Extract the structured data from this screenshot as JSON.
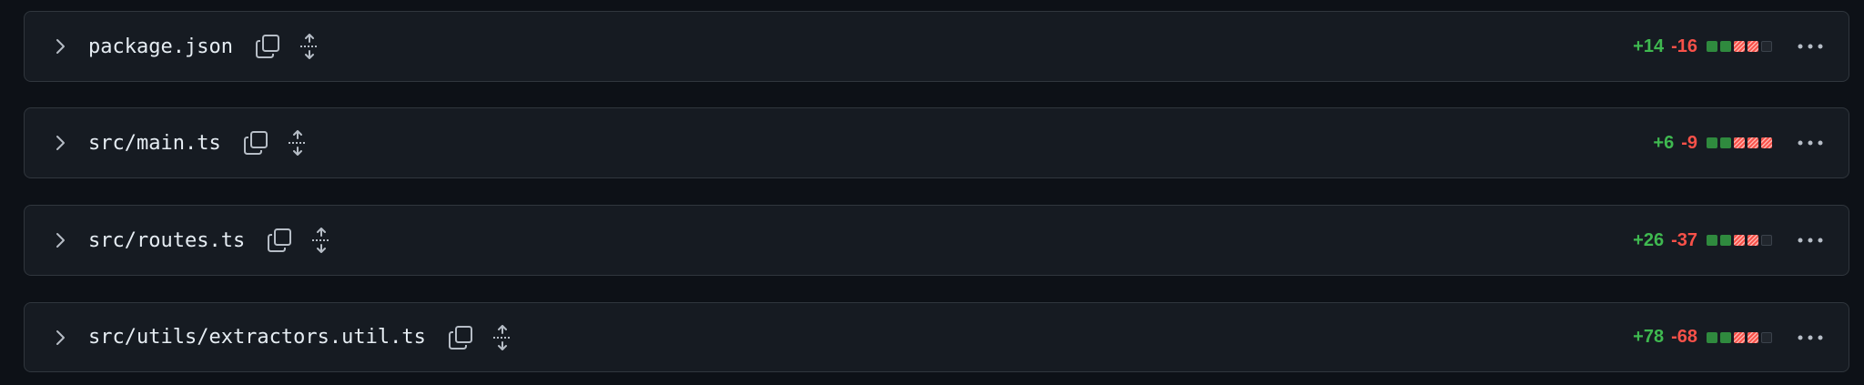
{
  "files": [
    {
      "path": "package.json",
      "additions": "+14",
      "deletions": "-16",
      "diffstat": [
        "add",
        "add",
        "del",
        "del",
        "neutral"
      ]
    },
    {
      "path": "src/main.ts",
      "additions": "+6",
      "deletions": "-9",
      "diffstat": [
        "add",
        "add",
        "del",
        "del",
        "del"
      ]
    },
    {
      "path": "src/routes.ts",
      "additions": "+26",
      "deletions": "-37",
      "diffstat": [
        "add",
        "add",
        "del",
        "del",
        "neutral"
      ]
    },
    {
      "path": "src/utils/extractors.util.ts",
      "additions": "+78",
      "deletions": "-68",
      "diffstat": [
        "add",
        "add",
        "del",
        "del",
        "neutral"
      ]
    }
  ],
  "icons": {
    "toggle": "chevron-right-icon",
    "copy": "copy-icon",
    "expand": "unfold-icon",
    "menu": "kebab-horizontal-icon"
  },
  "colors": {
    "additions": "#3fb950",
    "deletions": "#f85149",
    "background": "#0d1117",
    "row_background": "#161b22",
    "border": "#30363d"
  }
}
